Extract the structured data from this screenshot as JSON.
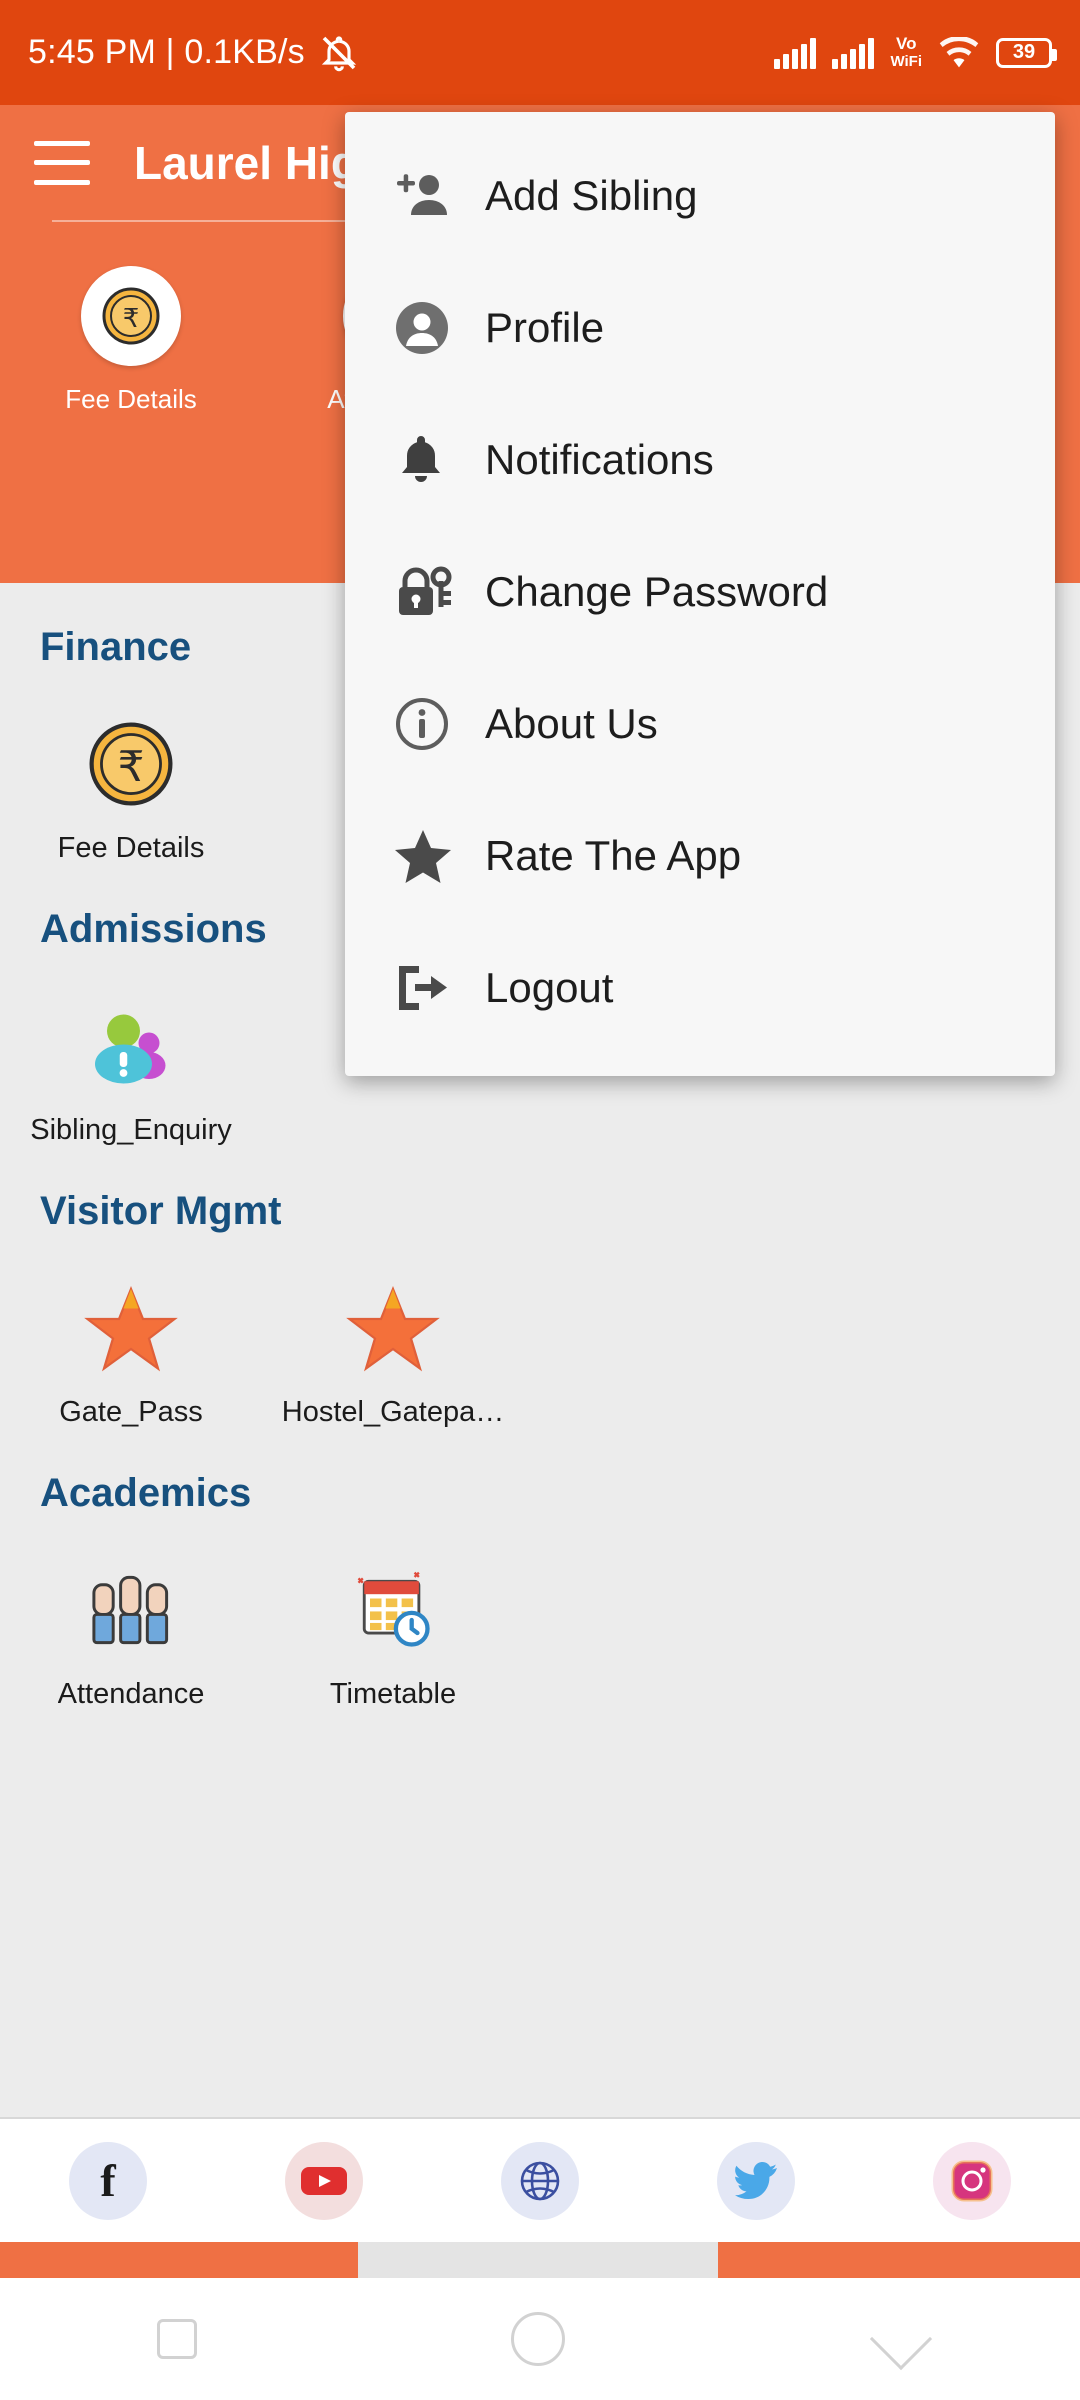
{
  "statusbar": {
    "clock": "5:45 PM | 0.1KB/s",
    "mute_icon": "bell-muted-icon",
    "signal1_icon": "signal-bars-icon",
    "signal2_icon": "signal-bars-icon",
    "volte_top": "Vo",
    "volte_bottom": "WiFi",
    "wifi_icon": "wifi-icon",
    "battery_level": "39",
    "bg_color": "#e0460f"
  },
  "appbar": {
    "menu_icon": "hamburger-icon",
    "title": "Laurel High G",
    "bg_color": "#ef7044",
    "quick_actions": [
      {
        "label": "Fee Details",
        "icon": "rupee-coin-icon"
      },
      {
        "label": "Attendance",
        "icon": "attendance-hands-icon"
      }
    ],
    "pager_dots": 2,
    "active_dot": 0
  },
  "menu": {
    "items": [
      {
        "label": "Add Sibling",
        "icon": "add-person-icon"
      },
      {
        "label": "Profile",
        "icon": "person-circle-icon"
      },
      {
        "label": "Notifications",
        "icon": "bell-icon"
      },
      {
        "label": "Change Password",
        "icon": "lock-key-icon"
      },
      {
        "label": "About Us",
        "icon": "info-circle-icon"
      },
      {
        "label": "Rate The App",
        "icon": "star-icon"
      },
      {
        "label": "Logout",
        "icon": "logout-icon"
      }
    ]
  },
  "sections": [
    {
      "title": "Finance",
      "tiles": [
        {
          "label": "Fee Details",
          "icon": "rupee-coin-icon"
        }
      ]
    },
    {
      "title": "Admissions",
      "tiles": [
        {
          "label": "Sibling_Enquiry",
          "icon": "sibling-enquiry-icon"
        }
      ]
    },
    {
      "title": "Visitor Mgmt",
      "tiles": [
        {
          "label": "Gate_Pass",
          "icon": "star-orange-icon"
        },
        {
          "label": "Hostel_Gatepa…",
          "icon": "star-orange-icon"
        }
      ]
    },
    {
      "title": "Academics",
      "tiles": [
        {
          "label": "Attendance",
          "icon": "attendance-hands-icon"
        },
        {
          "label": "Timetable",
          "icon": "timetable-calendar-icon"
        }
      ]
    }
  ],
  "social": [
    {
      "name": "facebook-icon",
      "label": "f"
    },
    {
      "name": "youtube-icon",
      "label": ""
    },
    {
      "name": "website-globe-icon",
      "label": ""
    },
    {
      "name": "twitter-icon",
      "label": ""
    },
    {
      "name": "instagram-icon",
      "label": ""
    }
  ],
  "colors": {
    "status_bar": "#e0460f",
    "app_bar": "#ef7044",
    "section_heading": "#17507e",
    "page_background": "#ececec",
    "accent_orange": "#f4703a"
  }
}
